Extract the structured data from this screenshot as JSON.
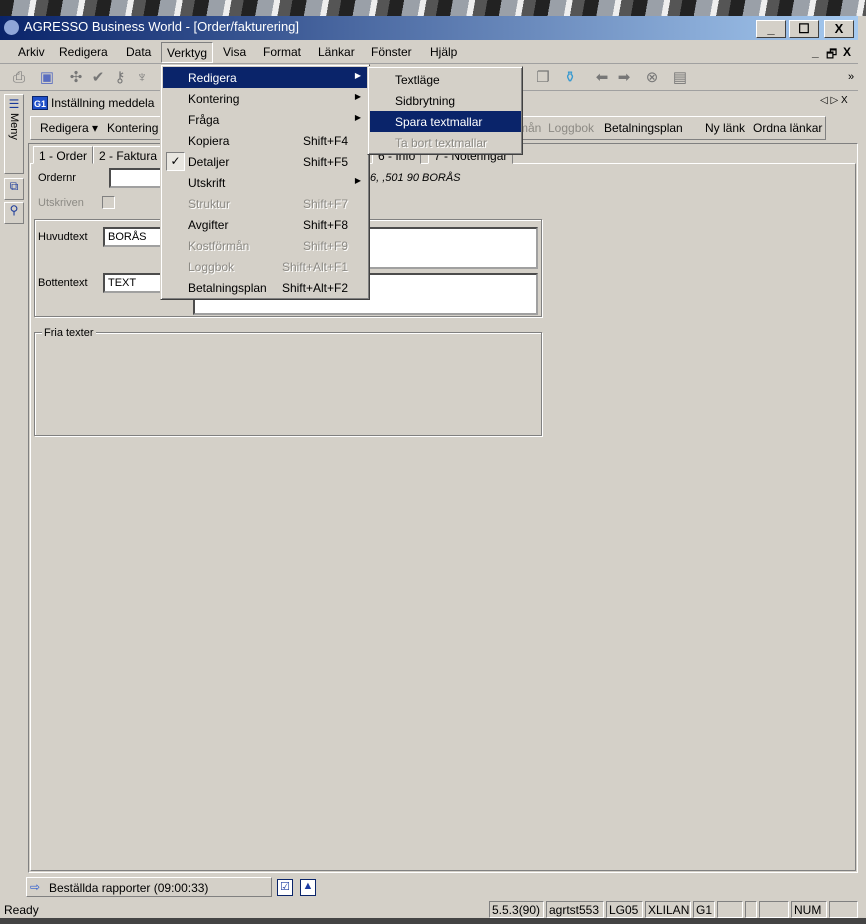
{
  "window": {
    "title": "AGRESSO Business World - [Order/fakturering]",
    "minimize": "_",
    "maximize": "☐",
    "close": "X"
  },
  "menubar": {
    "items": [
      "Arkiv",
      "Redigera",
      "Data",
      "Verktyg",
      "Visa",
      "Format",
      "Länkar",
      "Fönster",
      "Hjälp"
    ],
    "mdi_minimize": "_",
    "mdi_restore": "🗗",
    "mdi_close": "X"
  },
  "sidebar": {
    "meny": "Meny"
  },
  "document": {
    "title": "Inställning meddela",
    "badge": "G1",
    "nav": "◁ ▷ X"
  },
  "doc_toolbar": {
    "items": [
      "Redigera ▾",
      "Kontering",
      "Kostförmån",
      "Loggbok",
      "Betalningsplan",
      "Ny länk",
      "Ordna länkar"
    ]
  },
  "tabs": [
    "1 - Order",
    "2 - Faktura",
    "6 - Info",
    "7 - Noteringar"
  ],
  "form": {
    "ordernr_label": "Ordernr",
    "ordernr_value": "",
    "address": "6, ,501 90 BORÅS",
    "utskriven_label": "Utskriven",
    "huvudtext_label": "Huvudtext",
    "huvudtext_value": "BORÅS",
    "bottentext_label": "Bottentext",
    "bottentext_value": "TEXT",
    "fria_texter": "Fria texter"
  },
  "verktyg_menu": [
    {
      "label": "Redigera",
      "shortcut": "",
      "submenu": true,
      "state": "highlighted"
    },
    {
      "label": "Kontering",
      "shortcut": "",
      "submenu": true,
      "state": "enabled"
    },
    {
      "label": "Fråga",
      "shortcut": "",
      "submenu": true,
      "state": "enabled"
    },
    {
      "label": "Kopiera",
      "shortcut": "Shift+F4",
      "submenu": false,
      "state": "enabled"
    },
    {
      "label": "Detaljer",
      "shortcut": "Shift+F5",
      "submenu": false,
      "state": "checked"
    },
    {
      "label": "Utskrift",
      "shortcut": "",
      "submenu": true,
      "state": "enabled"
    },
    {
      "label": "Struktur",
      "shortcut": "Shift+F7",
      "submenu": false,
      "state": "disabled"
    },
    {
      "label": "Avgifter",
      "shortcut": "Shift+F8",
      "submenu": false,
      "state": "enabled"
    },
    {
      "label": "Kostförmån",
      "shortcut": "Shift+F9",
      "submenu": false,
      "state": "disabled"
    },
    {
      "label": "Loggbok",
      "shortcut": "Shift+Alt+F1",
      "submenu": false,
      "state": "disabled"
    },
    {
      "label": "Betalningsplan",
      "shortcut": "Shift+Alt+F2",
      "submenu": false,
      "state": "enabled"
    }
  ],
  "redigera_submenu": [
    {
      "label": "Textläge",
      "state": "enabled"
    },
    {
      "label": "Sidbrytning",
      "state": "enabled"
    },
    {
      "label": "Spara textmallar",
      "state": "highlighted"
    },
    {
      "label": "Ta bort textmallar",
      "state": "disabled"
    }
  ],
  "tasks": {
    "item": "Beställda rapporter (09:00:33)"
  },
  "status": {
    "text": "Ready",
    "panels": [
      "5.5.3(90)",
      "agrtst553",
      "LG05",
      "XLILAN",
      "G1",
      "",
      "",
      "",
      "NUM"
    ]
  },
  "colors": {
    "title_start": "#0a246a",
    "title_end": "#a6caf0",
    "highlight": "#0a246a",
    "face": "#d4d0c8"
  }
}
